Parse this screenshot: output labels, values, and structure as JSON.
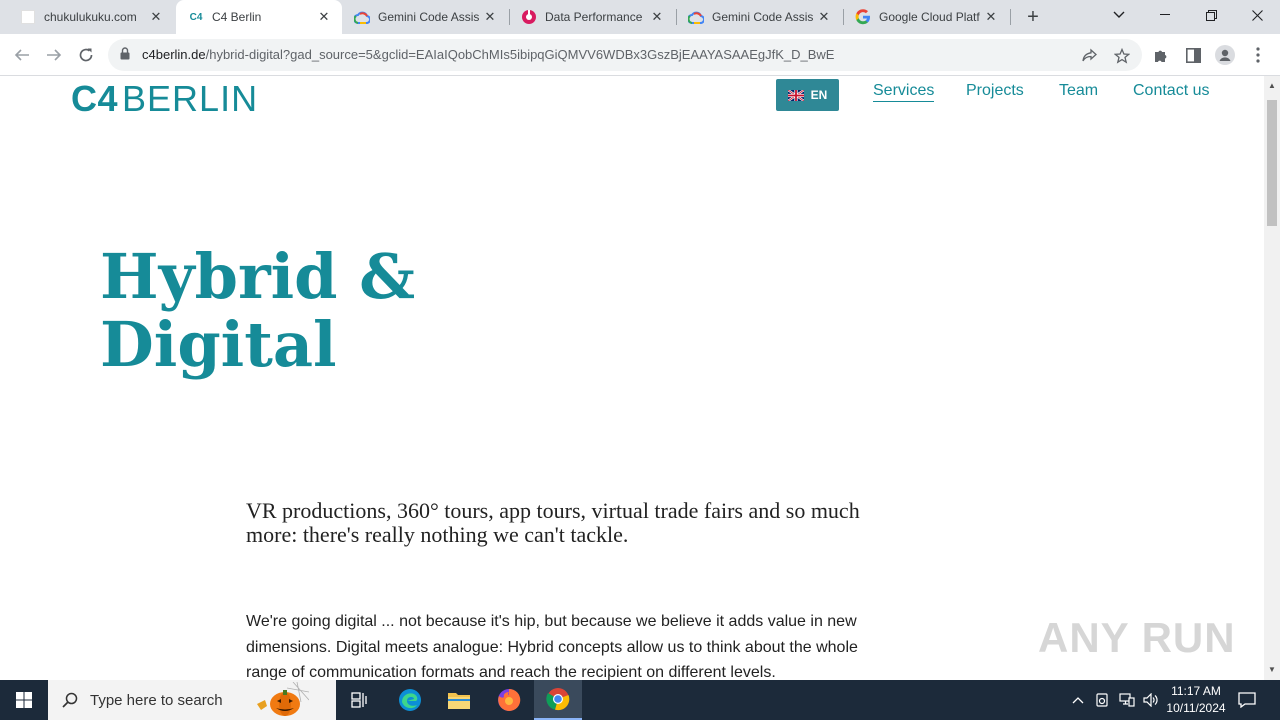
{
  "browser": {
    "tabs": [
      {
        "title": "chukulukuku.com",
        "favicon": "blank-page-icon"
      },
      {
        "title": "C4 Berlin",
        "favicon": "c4-favicon",
        "favicon_text": "C4"
      },
      {
        "title": "Gemini Code Assis",
        "favicon": "google-cloud-icon"
      },
      {
        "title": "Data Performance",
        "favicon": "data-performance-icon"
      },
      {
        "title": "Gemini Code Assis",
        "favicon": "google-cloud-icon"
      },
      {
        "title": "Google Cloud Platf",
        "favicon": "google-g-icon"
      }
    ],
    "active_tab_index": 1,
    "url_host": "c4berlin.de",
    "url_path": "/hybrid-digital?gad_source=5&gclid=EAIaIQobChMIs5ibipqGiQMVV6WDBx3GszBjEAAYASAAEgJfK_D_BwE"
  },
  "site": {
    "logo_c4": "C4",
    "logo_berlin": "BERLIN",
    "lang_label": "EN",
    "nav": [
      {
        "label": "Services",
        "active": true
      },
      {
        "label": "Projects",
        "active": false
      },
      {
        "label": "Team",
        "active": false
      },
      {
        "label": "Contact us",
        "active": false
      }
    ],
    "hero_line1": "Hybrid &",
    "hero_line2": "Digital",
    "lead": "VR productions, 360° tours, app tours, virtual trade fairs and so much more: there's really nothing we can't tackle.",
    "body": "We're going digital ... not because it's hip, but because we believe it adds value in new dimensions. Digital meets analogue: Hybrid concepts allow us to think about the whole range of communication formats and reach the recipient on different levels.",
    "watermark": "ANY RUN",
    "accent_color": "#168b98"
  },
  "taskbar": {
    "search_placeholder": "Type here to search",
    "time": "11:17 AM",
    "date": "10/11/2024"
  }
}
